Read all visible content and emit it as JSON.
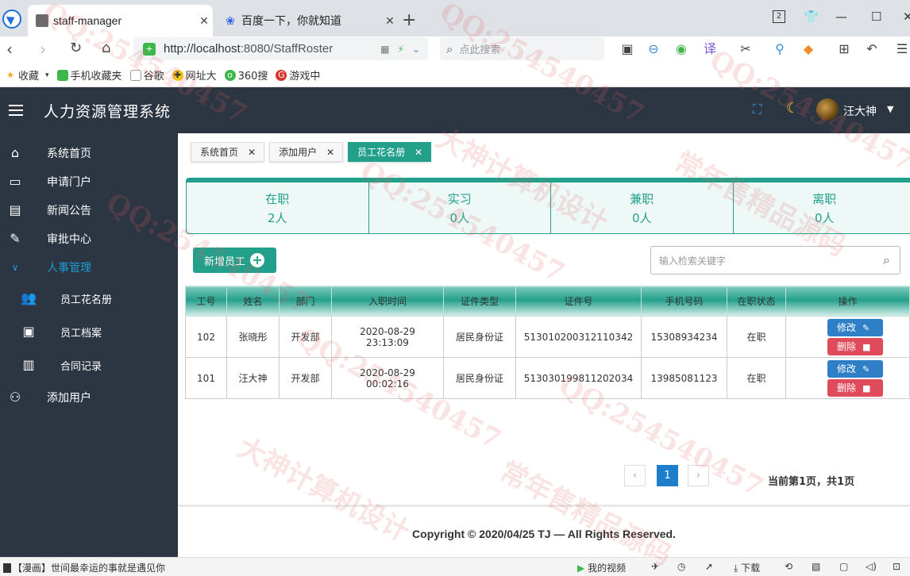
{
  "browser": {
    "tabs": [
      {
        "title": "staff-manager",
        "close": "✕"
      },
      {
        "title": "百度一下，你就知道",
        "close": "✕"
      }
    ],
    "new_tab": "+",
    "tab_count": "2",
    "url_host": "http://localhost",
    "url_rest": ":8080/StaffRoster",
    "search_placeholder": "点此搜索",
    "bookmarks": [
      {
        "label": "收藏",
        "icon": "star-icon"
      },
      {
        "label": "手机收藏夹",
        "icon": "phone-icon"
      },
      {
        "label": "谷歌",
        "icon": "page-icon"
      },
      {
        "label": "网址大",
        "icon": "globe-icon"
      },
      {
        "label": "360搜",
        "icon": "search-360-icon"
      },
      {
        "label": "游戏中",
        "icon": "game-icon"
      }
    ]
  },
  "app": {
    "title": "人力资源管理系统",
    "username": "汪大神"
  },
  "sidebar": {
    "items": [
      {
        "label": "系统首页",
        "icon": "home-icon"
      },
      {
        "label": "申请门户",
        "icon": "window-icon"
      },
      {
        "label": "新闻公告",
        "icon": "calendar-plus-icon"
      },
      {
        "label": "审批中心",
        "icon": "edit-doc-icon"
      },
      {
        "label": "人事管理",
        "icon": "chevron-down-icon"
      },
      {
        "label": "员工花名册",
        "icon": "users-icon"
      },
      {
        "label": "员工档案",
        "icon": "profile-file-icon"
      },
      {
        "label": "合同记录",
        "icon": "contract-icon"
      },
      {
        "label": "添加用户",
        "icon": "add-user-icon"
      }
    ]
  },
  "page_tabs": [
    {
      "label": "系统首页"
    },
    {
      "label": "添加用户"
    },
    {
      "label": "员工花名册"
    }
  ],
  "stats": [
    {
      "label": "在职",
      "value": "2人"
    },
    {
      "label": "实习",
      "value": "0人"
    },
    {
      "label": "兼职",
      "value": "0人"
    },
    {
      "label": "离职",
      "value": "0人"
    }
  ],
  "actions": {
    "add_label": "新增员工",
    "search_placeholder": "输入检索关键字"
  },
  "table": {
    "headers": [
      "工号",
      "姓名",
      "部门",
      "入职时间",
      "证件类型",
      "证件号",
      "手机号码",
      "在职状态",
      "操作"
    ],
    "rows": [
      {
        "id": "102",
        "name": "张晓彤",
        "dept": "开发部",
        "date": "2020-08-29",
        "time": "23:13:09",
        "idtype": "居民身份证",
        "idno": "513010200312110342",
        "phone": "15308934234",
        "status": "在职"
      },
      {
        "id": "101",
        "name": "汪大神",
        "dept": "开发部",
        "date": "2020-08-29",
        "time": "00:02:16",
        "idtype": "居民身份证",
        "idno": "513030199811202034",
        "phone": "13985081123",
        "status": "在职"
      }
    ],
    "edit_label": "修改",
    "delete_label": "删除"
  },
  "pager": {
    "prev": "‹",
    "current": "1",
    "next": "›",
    "info": "当前第1页，共1页"
  },
  "footer": {
    "copyright": "Copyright © 2020/04/25 TJ — All Rights Reserved."
  },
  "statusbar": {
    "left": "【漫画】世间最幸运的事就是遇见你",
    "video": "我的视频",
    "download": "下载"
  },
  "watermark": {
    "qq": "QQ:254540457",
    "a": "大神计算机设计",
    "b": "常年售精品源码"
  },
  "colors": {
    "primary": "#23a08b",
    "header_bg": "#2c3542",
    "edit_btn": "#2f7fc7",
    "delete_btn": "#e04b5b",
    "pager_active": "#1f7ec9"
  }
}
